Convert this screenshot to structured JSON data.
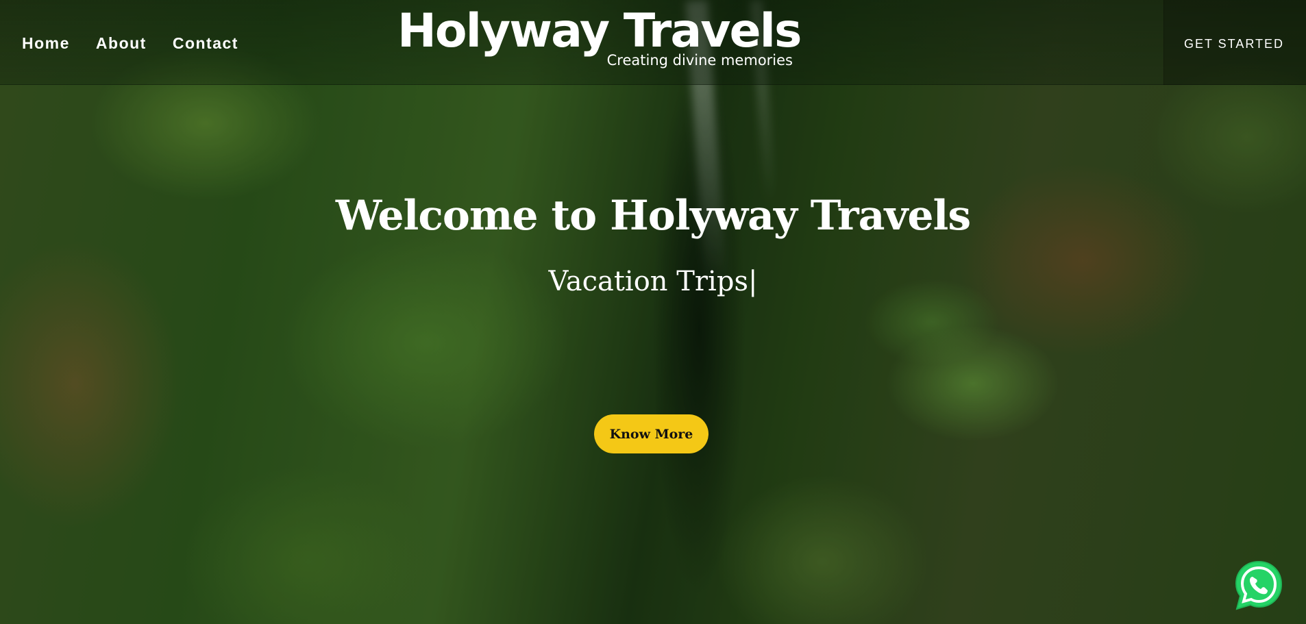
{
  "nav": {
    "items": [
      {
        "label": "Home"
      },
      {
        "label": "About"
      },
      {
        "label": "Contact"
      }
    ]
  },
  "logo": {
    "brand": "Holyway Travels",
    "tagline": "Creating divine memories"
  },
  "header": {
    "cta_label": "GET STARTED"
  },
  "hero": {
    "title": "Welcome to Holyway Travels",
    "typed_text": "Vacation Trips",
    "cursor": "|",
    "button_label": "Know More"
  },
  "colors": {
    "accent": "#f4c816",
    "whatsapp": "#25d366"
  },
  "floating": {
    "icon": "whatsapp-icon"
  }
}
